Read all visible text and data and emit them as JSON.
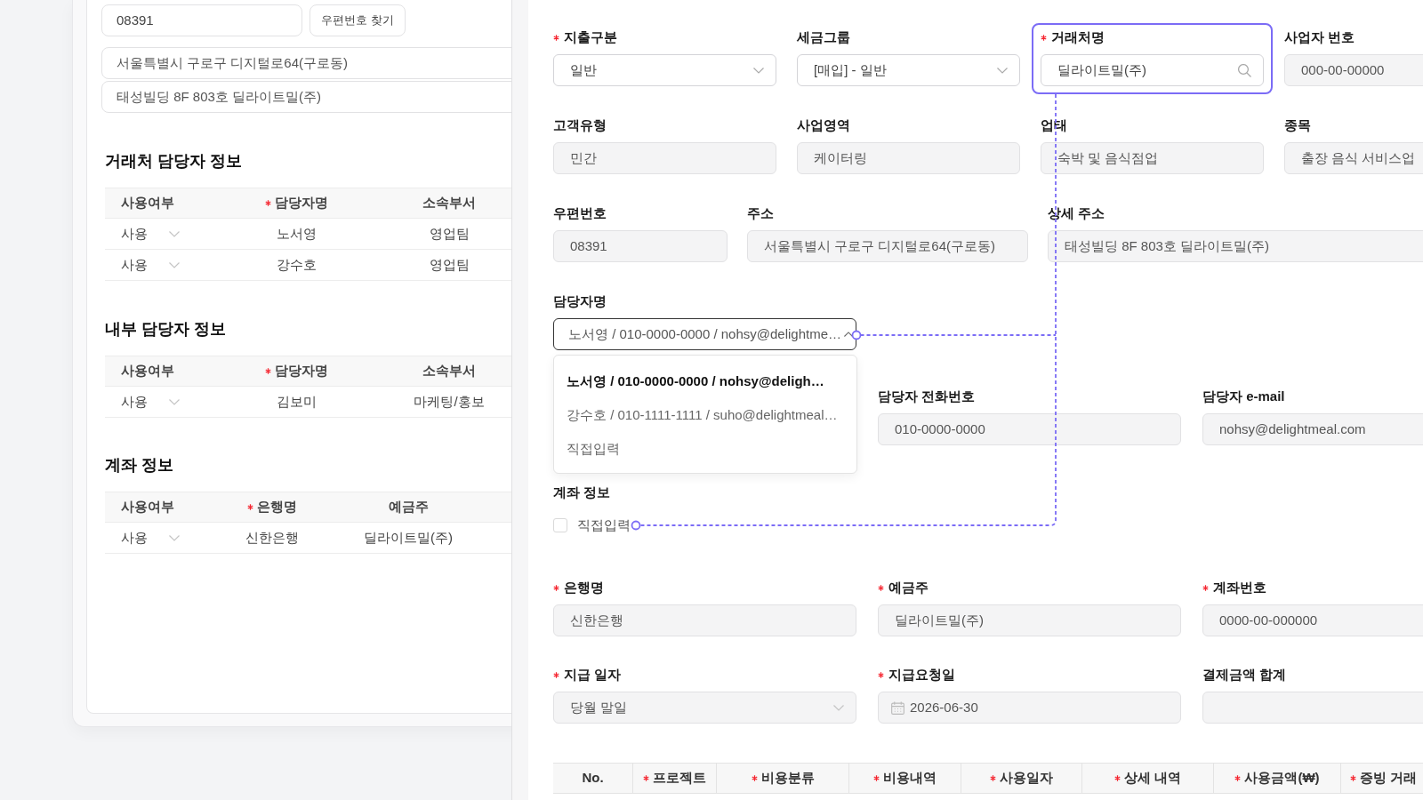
{
  "left_panel": {
    "postal_code": {
      "value": "08391"
    },
    "postal_search_button": {
      "label": "우편번호 찾기"
    },
    "address": {
      "value": "서울특별시 구로구 디지털로64(구로동)"
    },
    "address_detail": {
      "value": "태성빌딩 8F 803호 딜라이트밀(주)"
    },
    "sections": [
      {
        "title": "거래처 담당자 정보",
        "columns": [
          {
            "label": "사용여부",
            "required": false,
            "kind": "select"
          },
          {
            "label": "담당자명",
            "required": true,
            "kind": "text"
          },
          {
            "label": "소속부서",
            "required": false,
            "kind": "text"
          }
        ],
        "rows": [
          [
            "사용",
            "노서영",
            "영업팀"
          ],
          [
            "사용",
            "강수호",
            "영업팀"
          ]
        ]
      },
      {
        "title": "내부 담당자 정보",
        "columns": [
          {
            "label": "사용여부",
            "required": false,
            "kind": "select"
          },
          {
            "label": "담당자명",
            "required": true,
            "kind": "text"
          },
          {
            "label": "소속부서",
            "required": false,
            "kind": "text"
          }
        ],
        "rows": [
          [
            "사용",
            "김보미",
            "마케팅/홍보"
          ]
        ]
      },
      {
        "title": "계좌 정보",
        "columns": [
          {
            "label": "사용여부",
            "required": false,
            "kind": "select"
          },
          {
            "label": "은행명",
            "required": true,
            "kind": "text"
          },
          {
            "label": "예금주",
            "required": false,
            "kind": "text"
          }
        ],
        "rows": [
          [
            "사용",
            "신한은행",
            "딜라이트밀(주)"
          ]
        ]
      }
    ]
  },
  "right_panel": {
    "rows": [
      {
        "kind": "quad",
        "fields": [
          {
            "label": "지출구분",
            "required": true,
            "kind": "select",
            "value": "일반",
            "disabled": false,
            "open": false,
            "highlighted": false
          },
          {
            "label": "세금그룹",
            "required": false,
            "kind": "select",
            "value": "[매입] - 일반",
            "disabled": false,
            "open": false,
            "highlighted": false
          },
          {
            "label": "거래처명",
            "required": true,
            "kind": "search",
            "value": "딜라이트밀(주)",
            "disabled": false,
            "highlighted": true
          },
          {
            "label": "사업자 번호",
            "required": false,
            "kind": "text",
            "value": "000-00-00000",
            "disabled": true,
            "highlighted": false
          }
        ]
      },
      {
        "kind": "quad",
        "fields": [
          {
            "label": "고객유형",
            "required": false,
            "kind": "text",
            "value": "민간",
            "disabled": true,
            "highlighted": false
          },
          {
            "label": "사업영역",
            "required": false,
            "kind": "text",
            "value": "케이터링",
            "disabled": true,
            "highlighted": false
          },
          {
            "label": "업태",
            "required": false,
            "kind": "text",
            "value": "숙박 및 음식점업",
            "disabled": true,
            "highlighted": false
          },
          {
            "label": "종목",
            "required": false,
            "kind": "text",
            "value": "출장 음식 서비스업",
            "disabled": true,
            "highlighted": false
          }
        ]
      },
      {
        "kind": "address",
        "fields": [
          {
            "label": "우편번호",
            "required": false,
            "kind": "text",
            "value": "08391",
            "disabled": true,
            "highlighted": false
          },
          {
            "label": "주소",
            "required": false,
            "kind": "text",
            "value": "서울특별시 구로구 디지털로64(구로동)",
            "disabled": true,
            "highlighted": false
          },
          {
            "label": "상세 주소",
            "required": false,
            "kind": "text",
            "value": "태성빌딩 8F 803호 딜라이트밀(주)",
            "disabled": true,
            "highlighted": false
          }
        ]
      },
      {
        "kind": "contact",
        "fields": [
          {
            "label": "담당자명",
            "required": false,
            "kind": "select",
            "value": "노서영 / 010-0000-0000 / nohsy@delightme…",
            "disabled": false,
            "open": true,
            "highlighted": false,
            "options": [
              {
                "label": "노서영 / 010-0000-0000 / nohsy@deligh…",
                "selected": true
              },
              {
                "label": "강수호 / 010-1111-1111 / suho@delightmeal…",
                "selected": false
              },
              {
                "label": "직접입력",
                "selected": false
              }
            ]
          }
        ]
      },
      {
        "kind": "triple_offset",
        "fields": [
          {
            "label": "담당자 전화번호",
            "required": false,
            "kind": "text",
            "value": "010-0000-0000",
            "disabled": true,
            "highlighted": false
          },
          {
            "label": "담당자 e-mail",
            "required": false,
            "kind": "text",
            "value": "nohsy@delightmeal.com",
            "disabled": true,
            "highlighted": false
          }
        ]
      },
      {
        "kind": "checkbox",
        "title": "계좌 정보",
        "checkbox": {
          "label": "직접입력",
          "checked": false
        }
      },
      {
        "kind": "triple",
        "fields": [
          {
            "label": "은행명",
            "required": true,
            "kind": "text",
            "value": "신한은행",
            "disabled": true,
            "highlighted": false
          },
          {
            "label": "예금주",
            "required": true,
            "kind": "text",
            "value": "딜라이트밀(주)",
            "disabled": true,
            "highlighted": false
          },
          {
            "label": "계좌번호",
            "required": true,
            "kind": "text",
            "value": "0000-00-000000",
            "disabled": true,
            "highlighted": false
          }
        ]
      },
      {
        "kind": "triple",
        "fields": [
          {
            "label": "지급 일자",
            "required": true,
            "kind": "select",
            "value": "당월 말일",
            "disabled": true,
            "open": false,
            "highlighted": false
          },
          {
            "label": "지급요청일",
            "required": true,
            "kind": "date",
            "value": "2026-06-30",
            "disabled": true,
            "highlighted": false
          },
          {
            "label": "결제금액 합계",
            "required": false,
            "kind": "text",
            "disabled": true,
            "highlighted": false
          }
        ]
      }
    ],
    "expense_table": {
      "columns": [
        {
          "label": "No.",
          "required": false
        },
        {
          "label": "프로젝트",
          "required": true
        },
        {
          "label": "비용분류",
          "required": true
        },
        {
          "label": "비용내역",
          "required": true
        },
        {
          "label": "사용일자",
          "required": true
        },
        {
          "label": "상세 내역",
          "required": true
        },
        {
          "label": "사용금액(₩)",
          "required": true
        },
        {
          "label": "증빙 거래",
          "required": true
        }
      ]
    }
  }
}
